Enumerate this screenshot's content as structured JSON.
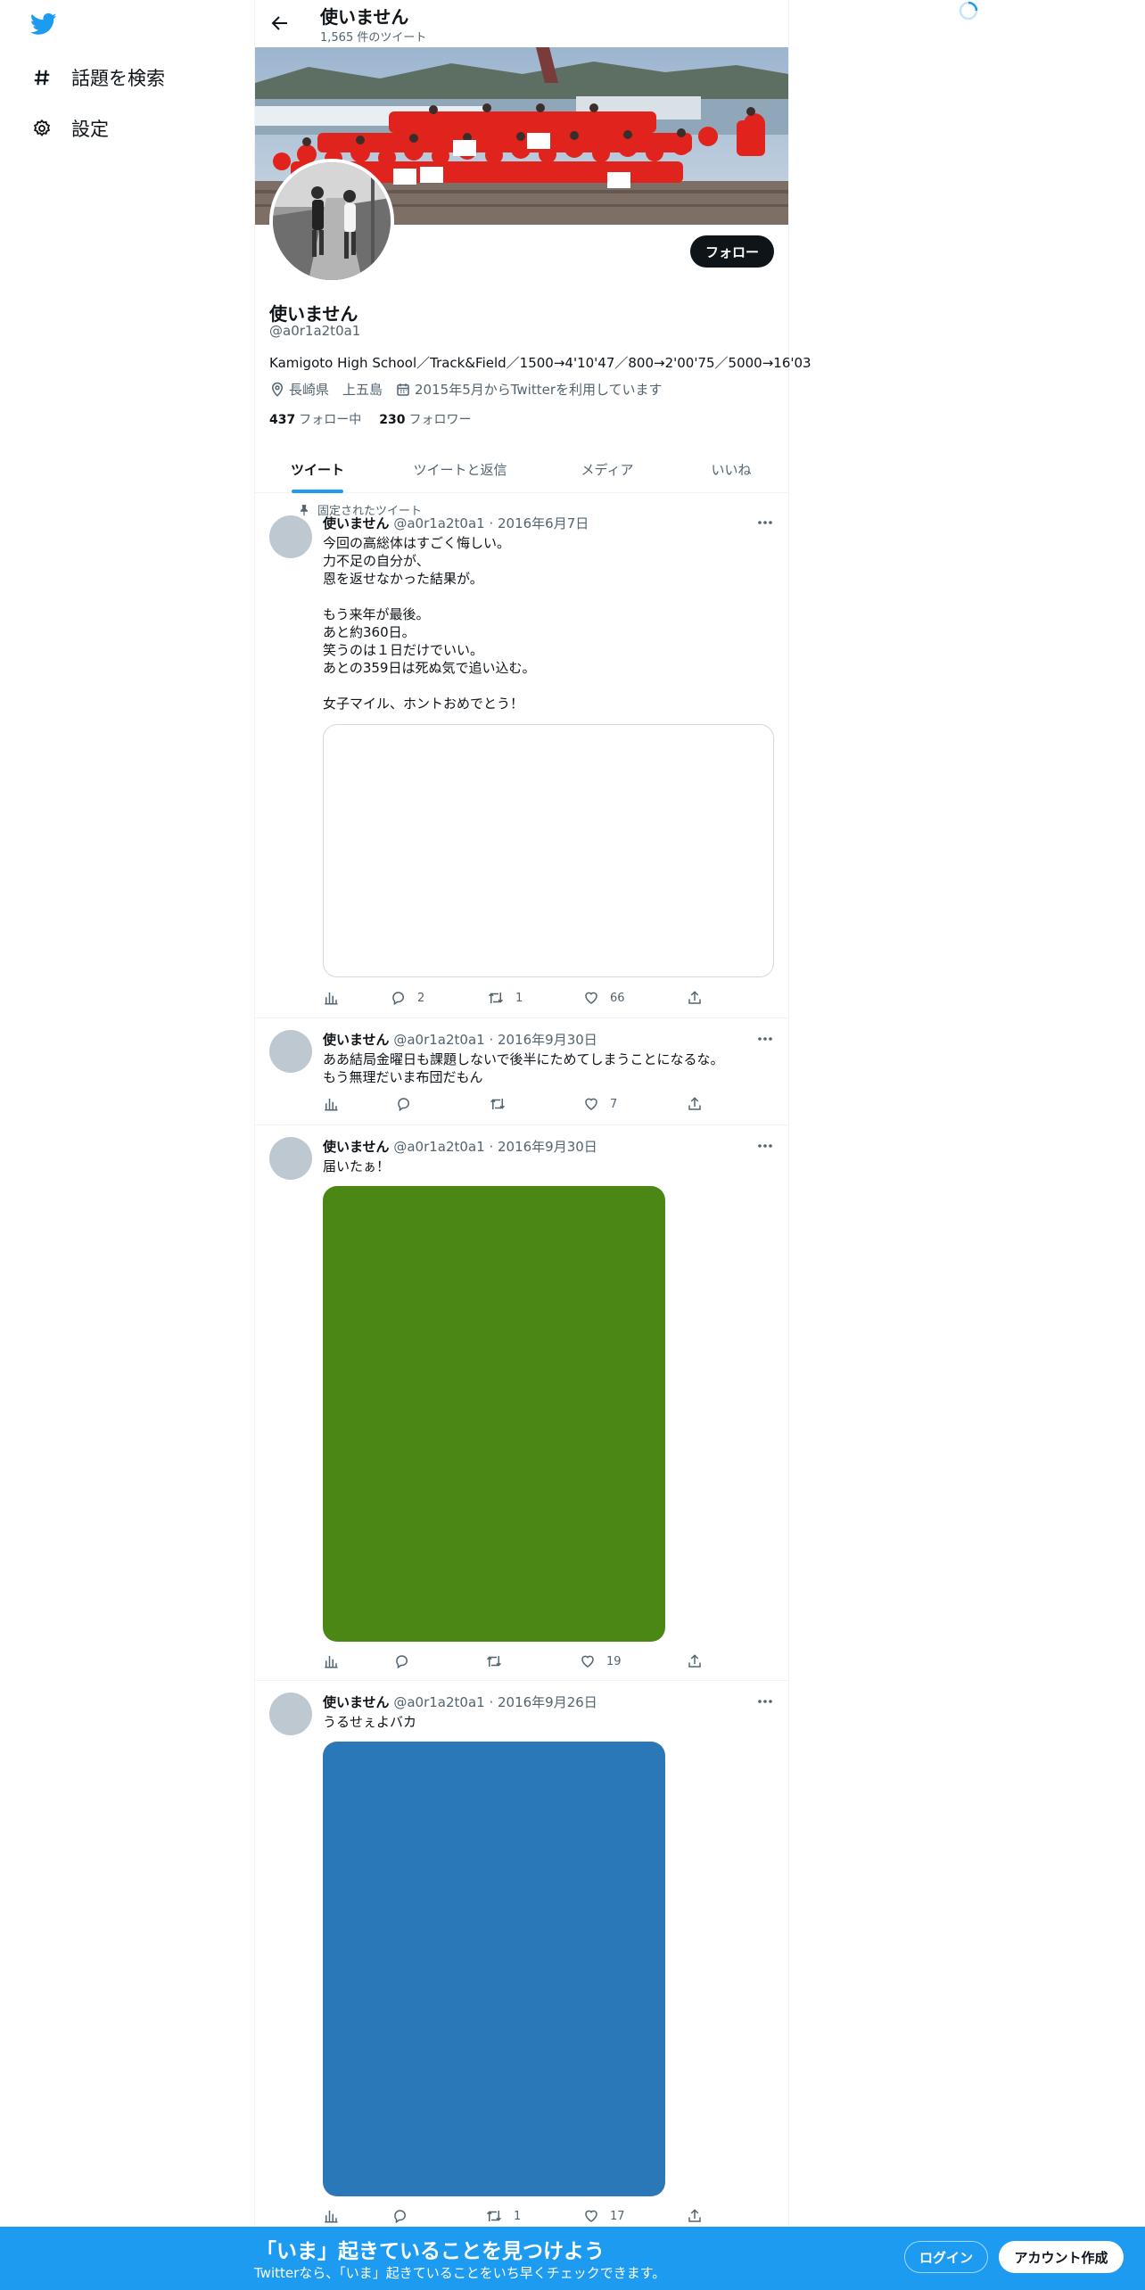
{
  "nav": {
    "logo_icon": "twitter-bird-icon",
    "explore_label": "話題を検索",
    "settings_label": "設定"
  },
  "header": {
    "title": "使いません",
    "tweet_count": "1,565 件のツイート"
  },
  "profile": {
    "name": "使いません",
    "handle": "@a0r1a2t0a1",
    "bio": "Kamigoto High School／Track&Field／1500→4'10'47／800→2'00'75／5000→16'03",
    "location": "長崎県　上五島",
    "joined": "2015年5月からTwitterを利用しています",
    "following_count": "437",
    "following_label": "フォロー中",
    "followers_count": "230",
    "followers_label": "フォロワー",
    "follow_button": "フォロー"
  },
  "tabs": [
    "ツイート",
    "ツイートと返信",
    "メディア",
    "いいね"
  ],
  "tweets": [
    {
      "pinned_label": "固定されたツイート",
      "name": "使いません",
      "handle_date": "@a0r1a2t0a1 · 2016年6月7日",
      "text": "今回の高総体はすごく悔しい。\n力不足の自分が、\n恩を返せなかった結果が。\n\nもう来年が最後。\nあと約360日。\n笑うのは１日だけでいい。\nあとの359日は死ぬ気で追い込む。\n\n女子マイル、ホントおめでとう！",
      "replies": "2",
      "retweets": "1",
      "likes": "66"
    },
    {
      "name": "使いません",
      "handle_date": "@a0r1a2t0a1 · 2016年9月30日",
      "text": "ああ結局金曜日も課題しないで後半にためてしまうことになるな。\nもう無理だいま布団だもん",
      "replies": "",
      "retweets": "",
      "likes": "7"
    },
    {
      "name": "使いません",
      "handle_date": "@a0r1a2t0a1 · 2016年9月30日",
      "text": "届いたぁ！",
      "media_color": "#4a8714",
      "replies": "",
      "retweets": "",
      "likes": "19"
    },
    {
      "name": "使いません",
      "handle_date": "@a0r1a2t0a1 · 2016年9月26日",
      "text": "うるせぇよバカ",
      "media_color": "#2b78b8",
      "replies": "",
      "retweets": "1",
      "likes": "17"
    }
  ],
  "bottom_bar": {
    "title": "「いま」起きていることを見つけよう",
    "subtitle": "Twitterなら、「いま」起きていることをいち早くチェックできます。",
    "login": "ログイン",
    "signup": "アカウント作成"
  },
  "colors": {
    "accent": "#1d9bf0",
    "text": "#0f1419",
    "muted": "#536471"
  }
}
